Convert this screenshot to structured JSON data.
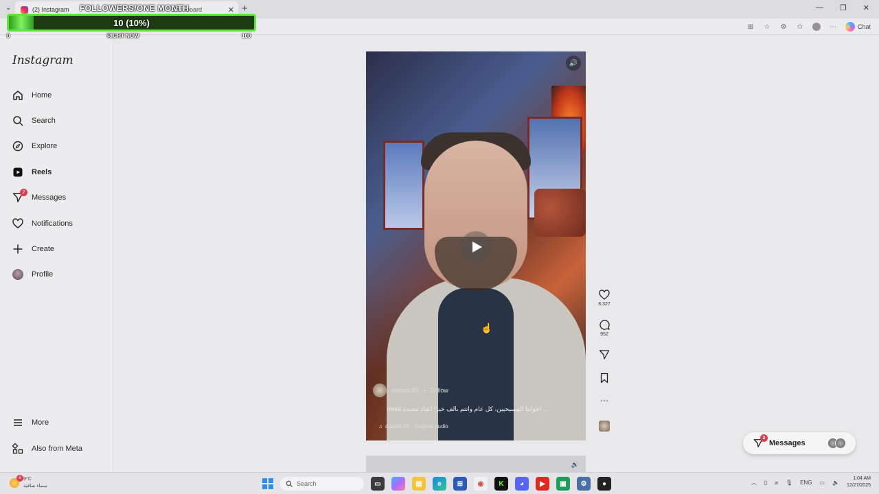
{
  "browser": {
    "tabs": [
      {
        "label": "(2) Instagram",
        "active": true
      },
      {
        "label": "Dashboard",
        "active": false
      }
    ],
    "chat_label": "Chat"
  },
  "overlay": {
    "title": "FOLLOWERS/ONE MONTH",
    "progress_text": "10 (10%)",
    "progress_fraction": 0.1,
    "min_label": "0",
    "mid_label": "RIGHT NOW",
    "max_label": "100"
  },
  "sidebar": {
    "logo": "Instagram",
    "items": [
      {
        "label": "Home",
        "icon": "home-icon"
      },
      {
        "label": "Search",
        "icon": "search-icon"
      },
      {
        "label": "Explore",
        "icon": "compass-icon"
      },
      {
        "label": "Reels",
        "icon": "reels-icon",
        "active": true
      },
      {
        "label": "Messages",
        "icon": "messenger-icon",
        "badge": "2"
      },
      {
        "label": "Notifications",
        "icon": "heart-icon"
      },
      {
        "label": "Create",
        "icon": "plus-icon"
      },
      {
        "label": "Profile",
        "icon": "avatar"
      }
    ],
    "bottom_items": [
      {
        "label": "More",
        "icon": "menu-icon"
      },
      {
        "label": "Also from Meta",
        "icon": "meta-apps-icon"
      }
    ]
  },
  "reel": {
    "username": "dabadi.89",
    "follow_label": "Follow",
    "separator": "•",
    "caption": "اخواننا المسيحيين، كل عام وانتم بالف خير! اعياد مجيدة ...",
    "more_label": "more",
    "audio": "dabadi.89 · Original audio",
    "likes": "8,327",
    "comments": "952"
  },
  "messages_pill": {
    "label": "Messages",
    "badge": "2"
  },
  "taskbar": {
    "weather_temp": "9°C",
    "weather_desc": "سماء صافية",
    "weather_badge": "6",
    "search_placeholder": "Search",
    "lang": "ENG",
    "time": "1:04 AM",
    "date": "12/27/2025"
  },
  "colors": {
    "progress_border": "#5fe63a",
    "badge": "#e23b4d"
  }
}
